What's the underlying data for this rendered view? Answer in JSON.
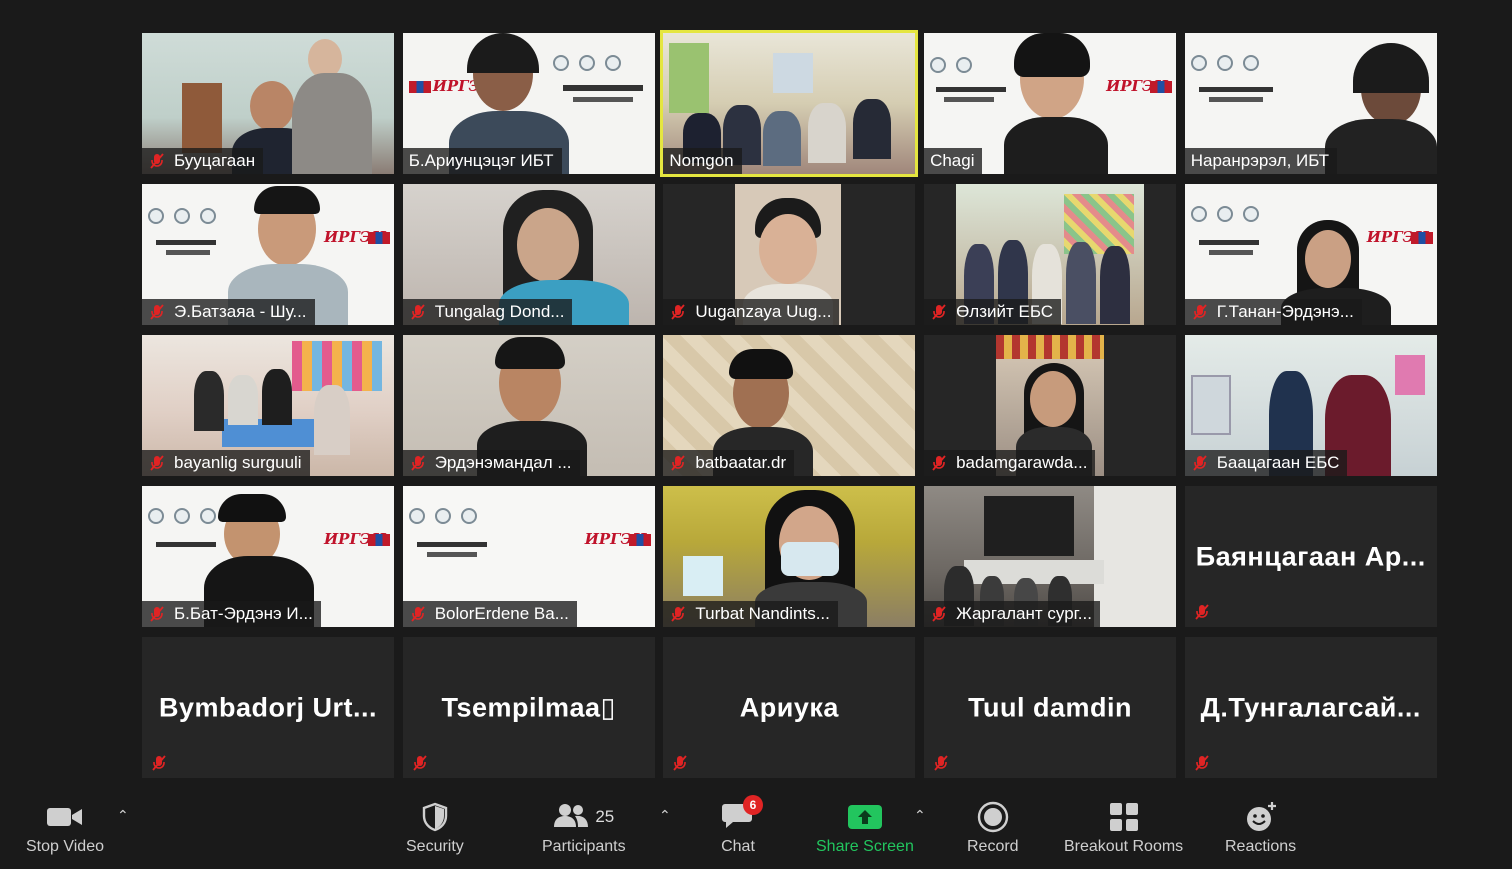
{
  "participants": [
    {
      "name": "Бууцагаан",
      "muted": true,
      "video": true
    },
    {
      "name": "Б.Ариунцэцэг ИБТ",
      "muted": false,
      "video": true
    },
    {
      "name": "Nomgon",
      "muted": false,
      "video": true,
      "active": true
    },
    {
      "name": "Chagi",
      "muted": false,
      "video": true
    },
    {
      "name": "Наранрэрэл, ИБТ",
      "muted": false,
      "video": true
    },
    {
      "name": "Э.Батзаяа - Шу...",
      "muted": true,
      "video": true
    },
    {
      "name": "Tungalag Dond...",
      "muted": true,
      "video": true
    },
    {
      "name": "Uuganzaya Uug...",
      "muted": true,
      "video": true
    },
    {
      "name": "Өлзийт ЕБС",
      "muted": true,
      "video": true
    },
    {
      "name": "Г.Танан-Эрдэнэ...",
      "muted": true,
      "video": true
    },
    {
      "name": "bayanlig surguuli",
      "muted": true,
      "video": true
    },
    {
      "name": "Эрдэнэмандал ...",
      "muted": true,
      "video": true
    },
    {
      "name": "batbaatar.dr",
      "muted": true,
      "video": true
    },
    {
      "name": "badamgarawda...",
      "muted": true,
      "video": true
    },
    {
      "name": "Баацагаан ЕБС",
      "muted": true,
      "video": true
    },
    {
      "name": "Б.Бат-Эрдэнэ И...",
      "muted": true,
      "video": true
    },
    {
      "name": "BolorErdene Ba...",
      "muted": true,
      "video": true
    },
    {
      "name": "Turbat Nandints...",
      "muted": true,
      "video": true
    },
    {
      "name": "Жаргалант сург...",
      "muted": true,
      "video": true
    },
    {
      "name": "Баянцагаан Ар...",
      "muted": true,
      "video": false
    },
    {
      "name": "Bymbadorj  Urt...",
      "muted": true,
      "video": false
    },
    {
      "name": "Tsempilmaa▯",
      "muted": true,
      "video": false
    },
    {
      "name": "Ариука",
      "muted": true,
      "video": false
    },
    {
      "name": "Tuul damdin",
      "muted": true,
      "video": false
    },
    {
      "name": "Д.Тунгалагсай...",
      "muted": true,
      "video": false
    }
  ],
  "toolbar": {
    "stop_video": "Stop Video",
    "security": "Security",
    "participants": "Participants",
    "participants_count": "25",
    "chat": "Chat",
    "chat_badge": "6",
    "share_screen": "Share Screen",
    "record": "Record",
    "breakout_rooms": "Breakout Rooms",
    "reactions": "Reactions"
  },
  "colors": {
    "background": "#1a1a1a",
    "tile": "#262626",
    "active_border": "#e5e640",
    "muted_red": "#e02424",
    "share_green": "#22c55e"
  },
  "icons": {
    "muted": "mic-muted-icon",
    "video": "video-camera-icon",
    "security": "shield-icon",
    "participants": "people-icon",
    "chat": "chat-bubble-icon",
    "share": "share-screen-icon",
    "record": "record-icon",
    "breakout": "breakout-grid-icon",
    "reactions": "smile-plus-icon"
  }
}
